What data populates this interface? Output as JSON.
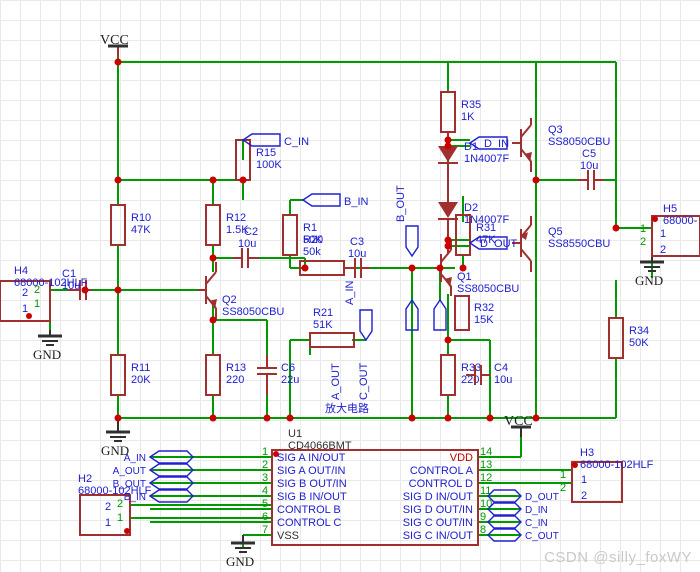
{
  "sheet": {
    "title_label": "放大电路",
    "watermark": "CSDN @silly_foxWY",
    "colors": {
      "wire": "#009900",
      "component": "#A03030",
      "net_label": "#2020D0",
      "power_text": "#202020",
      "vdd_text": "#C00000",
      "grid": "#e9e9e9",
      "junction": "#CC0000",
      "background": "#ffffff"
    }
  },
  "power_symbols": [
    {
      "name": "vcc-top",
      "label": "VCC"
    },
    {
      "name": "vcc-ic",
      "label": "VCC"
    }
  ],
  "ground_symbols": [
    {
      "name": "gnd-h4",
      "label": "GND"
    },
    {
      "name": "gnd-left-rail",
      "label": "GND"
    },
    {
      "name": "gnd-h5",
      "label": "GND"
    },
    {
      "name": "gnd-ic-vss",
      "label": "GND"
    }
  ],
  "resistors": [
    {
      "ref": "R10",
      "value": "47K"
    },
    {
      "ref": "R11",
      "value": "20K"
    },
    {
      "ref": "R12",
      "value": "1.5K"
    },
    {
      "ref": "R13",
      "value": "220"
    },
    {
      "ref": "R15",
      "value": "100K"
    },
    {
      "ref": "R1",
      "value": "50K"
    },
    {
      "ref": "R20",
      "value": "50k"
    },
    {
      "ref": "R21",
      "value": "51K"
    },
    {
      "ref": "R31",
      "value": "47K"
    },
    {
      "ref": "R32",
      "value": "15K"
    },
    {
      "ref": "R33",
      "value": "220"
    },
    {
      "ref": "R34",
      "value": "50K"
    },
    {
      "ref": "R35",
      "value": "1K"
    }
  ],
  "capacitors": [
    {
      "ref": "C1",
      "value": "10u"
    },
    {
      "ref": "C2",
      "value": "10u"
    },
    {
      "ref": "C3",
      "value": "10u"
    },
    {
      "ref": "C4",
      "value": "10u"
    },
    {
      "ref": "C5",
      "value": "10u"
    },
    {
      "ref": "C6",
      "value": "22u"
    }
  ],
  "transistors": [
    {
      "ref": "Q1",
      "part": "SS8050CBU"
    },
    {
      "ref": "Q2",
      "part": "SS8050CBU"
    },
    {
      "ref": "Q3",
      "part": "SS8050CBU"
    },
    {
      "ref": "Q5",
      "part": "SS8550CBU"
    }
  ],
  "diodes": [
    {
      "ref": "D1",
      "part": "1N4007F"
    },
    {
      "ref": "D2",
      "part": "1N4007F"
    }
  ],
  "connectors": [
    {
      "ref": "H4",
      "part": "68000-102HLF",
      "pins": [
        "2",
        "1"
      ]
    },
    {
      "ref": "H5",
      "part": "68000-",
      "pins": [
        "1",
        "2"
      ]
    },
    {
      "ref": "H2",
      "part": "68000-102HLF",
      "pins": [
        "2",
        "1"
      ]
    },
    {
      "ref": "H3",
      "part": "68000-102HLF",
      "pins": [
        "1",
        "2"
      ]
    }
  ],
  "ic": {
    "ref": "U1",
    "part": "CD4066BMT",
    "left_pins": [
      {
        "num": "1",
        "label": "SIG A IN/OUT"
      },
      {
        "num": "2",
        "label": "SIG A OUT/IN"
      },
      {
        "num": "3",
        "label": "SIG B OUT/IN"
      },
      {
        "num": "4",
        "label": "SIG B IN/OUT"
      },
      {
        "num": "5",
        "label": "CONTROL B"
      },
      {
        "num": "6",
        "label": "CONTROL C"
      },
      {
        "num": "7",
        "label": "VSS"
      }
    ],
    "right_pins": [
      {
        "num": "14",
        "label": "VDD",
        "power": true
      },
      {
        "num": "13",
        "label": "CONTROL A",
        "power": false
      },
      {
        "num": "12",
        "label": "CONTROL D",
        "power": false
      },
      {
        "num": "11",
        "label": "SIG D IN/OUT",
        "power": false
      },
      {
        "num": "10",
        "label": "SIG D OUT/IN",
        "power": false
      },
      {
        "num": "9",
        "label": "SIG C OUT/IN",
        "power": false
      },
      {
        "num": "8",
        "label": "SIG C IN/OUT",
        "power": false
      }
    ]
  },
  "net_labels": [
    {
      "name": "net-c-in",
      "text": "C_IN"
    },
    {
      "name": "net-b-in",
      "text": "B_IN"
    },
    {
      "name": "net-a-in",
      "text": "A_IN"
    },
    {
      "name": "net-b-out",
      "text": "B_OUT"
    },
    {
      "name": "net-a-out",
      "text": "A_OUT"
    },
    {
      "name": "net-c-out",
      "text": "C_OUT"
    },
    {
      "name": "net-d-in",
      "text": "D_IN"
    },
    {
      "name": "net-d-out",
      "text": "D_OUT"
    },
    {
      "name": "net-ic-a-in",
      "text": "A_IN"
    },
    {
      "name": "net-ic-a-out",
      "text": "A_OUT"
    },
    {
      "name": "net-ic-b-out",
      "text": "B_OUT"
    },
    {
      "name": "net-ic-b-in",
      "text": "B_IN"
    },
    {
      "name": "net-ic-d-out",
      "text": "D_OUT"
    },
    {
      "name": "net-ic-d-in",
      "text": "D_IN"
    },
    {
      "name": "net-ic-c-in",
      "text": "C_IN"
    },
    {
      "name": "net-ic-c-out",
      "text": "C_OUT"
    }
  ]
}
